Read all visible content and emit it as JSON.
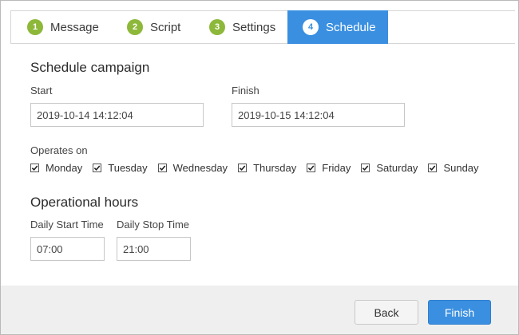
{
  "steps": [
    {
      "num": "1",
      "label": "Message"
    },
    {
      "num": "2",
      "label": "Script"
    },
    {
      "num": "3",
      "label": "Settings"
    },
    {
      "num": "4",
      "label": "Schedule"
    }
  ],
  "colors": {
    "accent": "#3a8fe0",
    "step_badge": "#8db83a",
    "footer_bg": "#efefef"
  },
  "schedule": {
    "title": "Schedule campaign",
    "start_label": "Start",
    "start_value": "2019-10-14 14:12:04",
    "finish_label": "Finish",
    "finish_value": "2019-10-15 14:12:04"
  },
  "operates": {
    "label": "Operates on",
    "days": [
      {
        "label": "Monday",
        "checked": true
      },
      {
        "label": "Tuesday",
        "checked": true
      },
      {
        "label": "Wednesday",
        "checked": true
      },
      {
        "label": "Thursday",
        "checked": true
      },
      {
        "label": "Friday",
        "checked": true
      },
      {
        "label": "Saturday",
        "checked": true
      },
      {
        "label": "Sunday",
        "checked": true
      }
    ]
  },
  "hours": {
    "title": "Operational hours",
    "start_label": "Daily Start Time",
    "start_value": "07:00",
    "stop_label": "Daily Stop Time",
    "stop_value": "21:00"
  },
  "footer": {
    "back_label": "Back",
    "finish_label": "Finish"
  }
}
